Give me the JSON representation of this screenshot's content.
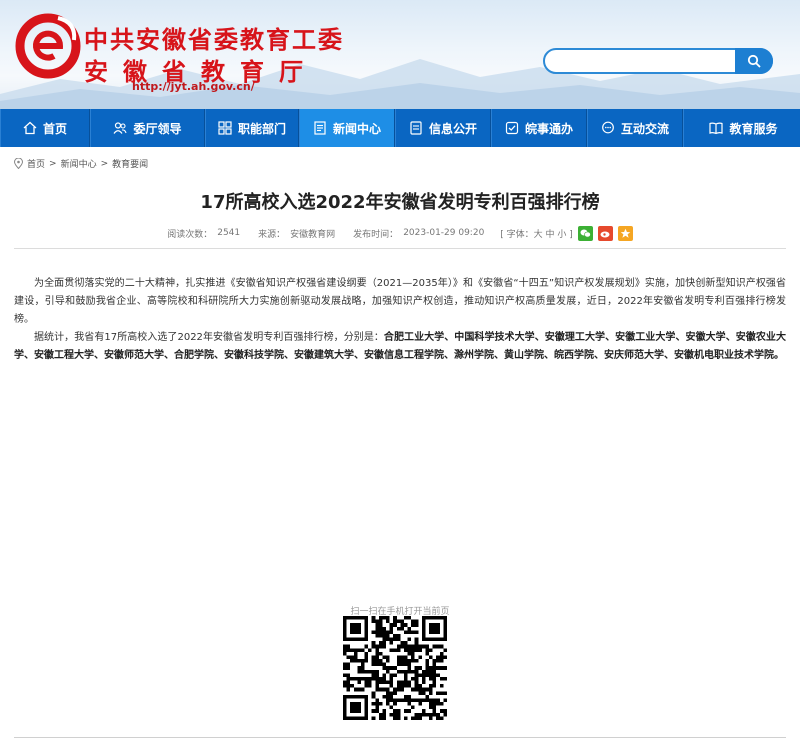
{
  "header": {
    "title_line1": "中共安徽省委教育工委",
    "title_line2": "安徽省教育厅",
    "url": "http://jyt.ah.gov.cn/",
    "search": {
      "value": "",
      "placeholder": ""
    },
    "colors": {
      "brand_red": "#d7141a",
      "nav_blue": "#0a66c2",
      "nav_active": "#1e8ee6"
    }
  },
  "nav": [
    {
      "label": "首页",
      "icon": "home-icon"
    },
    {
      "label": "委厅领导",
      "icon": "leaders-icon"
    },
    {
      "label": "职能部门",
      "icon": "departments-icon"
    },
    {
      "label": "新闻中心",
      "icon": "news-icon",
      "active": true
    },
    {
      "label": "信息公开",
      "icon": "disclosure-icon"
    },
    {
      "label": "皖事通办",
      "icon": "services-icon"
    },
    {
      "label": "互动交流",
      "icon": "chat-icon"
    },
    {
      "label": "教育服务",
      "icon": "book-icon"
    }
  ],
  "breadcrumb": [
    "首页",
    "新闻中心",
    "教育要闻"
  ],
  "article": {
    "title": "17所高校入选2022年安徽省发明专利百强排行榜",
    "views_label": "阅读次数：",
    "views": "2541",
    "source_label": "来源：",
    "source": "安徽教育网",
    "time_label": "发布时间：",
    "time": "2023-01-29 09:20",
    "font_label": "[ 字体：大 中 小 ]",
    "paragraph1": "为全面贯彻落实党的二十大精神，扎实推进《安徽省知识产权强省建设纲要（2021—2035年）》和《安徽省“十四五”知识产权发展规划》实施，加快创新型知识产权强省建设，引导和鼓励我省企业、高等院校和科研院所大力实施创新驱动发展战略，加强知识产权创造，推动知识产权高质量发展，近日，2022年安徽省发明专利百强排行榜发榜。",
    "paragraph2_plain": "据统计，我省有17所高校入选了2022年安徽省发明专利百强排行榜，分别是：",
    "paragraph2_bold": "合肥工业大学、中国科学技术大学、安徽理工大学、安徽工业大学、安徽大学、安徽农业大学、安徽工程大学、安徽师范大学、合肥学院、安徽科技学院、安徽建筑大学、安徽信息工程学院、滁州学院、黄山学院、皖西学院、安庆师范大学、安徽机电职业技术学院。"
  },
  "qr": {
    "label": "扫一扫在手机打开当前页"
  }
}
